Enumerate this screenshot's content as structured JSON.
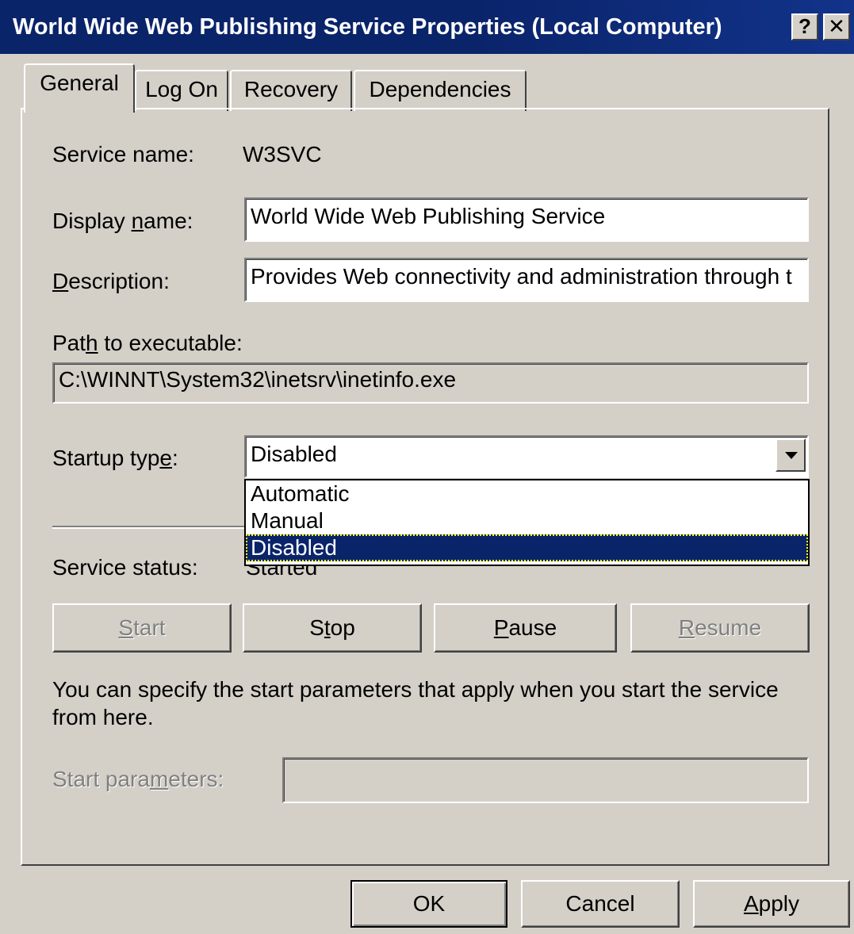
{
  "window": {
    "title": "World Wide Web Publishing Service Properties (Local Computer)",
    "help_glyph": "?",
    "close_glyph": "✕"
  },
  "tabs": [
    {
      "label": "General",
      "active": true
    },
    {
      "label": "Log On",
      "active": false
    },
    {
      "label": "Recovery",
      "active": false
    },
    {
      "label": "Dependencies",
      "active": false
    }
  ],
  "general": {
    "service_name_label": "Service name:",
    "service_name_value": "W3SVC",
    "display_name_label_pre": "Display ",
    "display_name_label_key": "n",
    "display_name_label_post": "ame:",
    "display_name_value": "World Wide Web Publishing Service",
    "description_label_key": "D",
    "description_label_post": "escription:",
    "description_value": "Provides Web connectivity and administration through t",
    "path_label_pre": "Pat",
    "path_label_key": "h",
    "path_label_post": " to executable:",
    "path_value": "C:\\WINNT\\System32\\inetsrv\\inetinfo.exe",
    "startup_type_label_pre": "Startup typ",
    "startup_type_label_key": "e",
    "startup_type_label_post": ":",
    "startup_type_value": "Disabled",
    "startup_type_options": [
      "Automatic",
      "Manual",
      "Disabled"
    ],
    "startup_type_selected": "Disabled",
    "service_status_label": "Service status:",
    "service_status_value": "Started",
    "buttons": {
      "start_key": "S",
      "start_rest": "tart",
      "stop_pre": "S",
      "stop_key": "t",
      "stop_rest": "op",
      "pause_key": "P",
      "pause_rest": "ause",
      "resume_key": "R",
      "resume_rest": "esume"
    },
    "help_text": "You can specify the start parameters that apply when you start the service from here.",
    "start_params_label_pre": "Start para",
    "start_params_label_key": "m",
    "start_params_label_post": "eters:",
    "start_params_value": ""
  },
  "footer": {
    "ok_label": "OK",
    "cancel_label": "Cancel",
    "apply_key": "A",
    "apply_rest": "pply"
  },
  "colors": {
    "titlebar": "#0a246a",
    "face": "#d4d0c8",
    "selection": "#0a246a"
  }
}
